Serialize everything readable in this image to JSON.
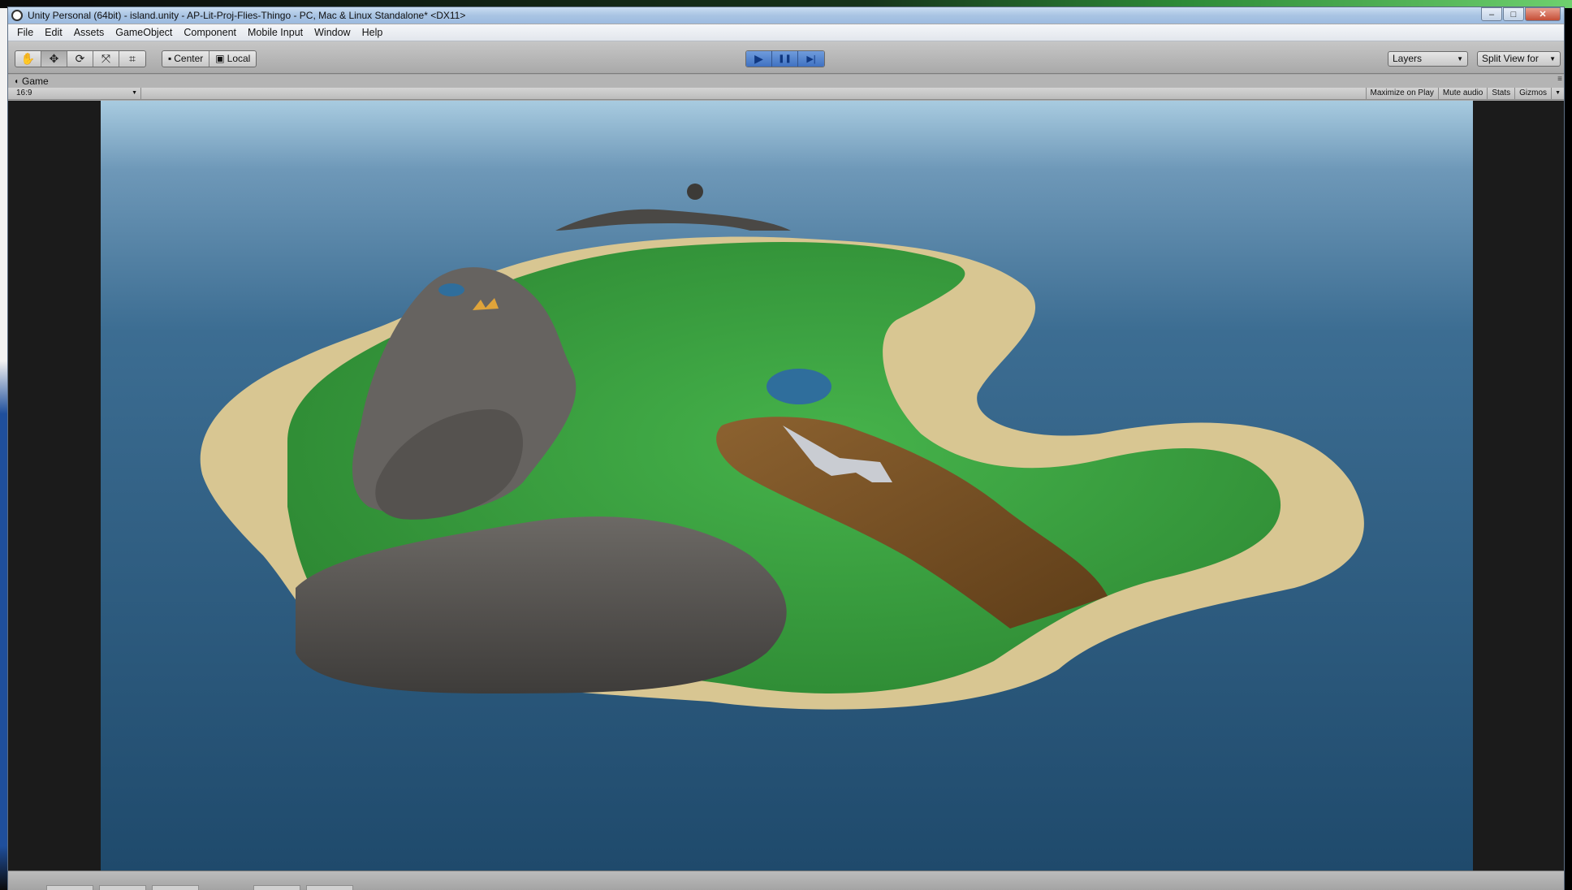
{
  "window": {
    "title": "Unity Personal (64bit) - island.unity - AP-Lit-Proj-Flies-Thingo - PC, Mac & Linux Standalone* <DX11>",
    "controls": {
      "minimize": "‒",
      "maximize": "□",
      "close": "✕"
    }
  },
  "menu": {
    "items": [
      "File",
      "Edit",
      "Assets",
      "GameObject",
      "Component",
      "Mobile Input",
      "Window",
      "Help"
    ]
  },
  "toolbar": {
    "transform_tools": [
      {
        "name": "hand-tool",
        "icon": "✋"
      },
      {
        "name": "move-tool",
        "icon": "✥"
      },
      {
        "name": "rotate-tool",
        "icon": "⟳"
      },
      {
        "name": "scale-tool",
        "icon": "⤧"
      },
      {
        "name": "rect-tool",
        "icon": "⌗"
      }
    ],
    "pivot_center": "Center",
    "pivot_local": "Local",
    "play_icon": "▶",
    "pause_icon": "❚❚",
    "step_icon": "▶|",
    "layers_label": "Layers",
    "layout_label": "Split View for"
  },
  "game_panel": {
    "tab_label": "Game",
    "aspect": "16:9",
    "toggles": [
      "Maximize on Play",
      "Mute audio",
      "Stats",
      "Gizmos"
    ]
  },
  "colors": {
    "sky_top": "#a8cbe0",
    "ocean": "#2f5f86",
    "grass": "#3aa23f",
    "sand": "#d8c692",
    "rock": "#5f5c58",
    "dirt": "#7b5326",
    "play_accent": "#4a7fcd"
  }
}
